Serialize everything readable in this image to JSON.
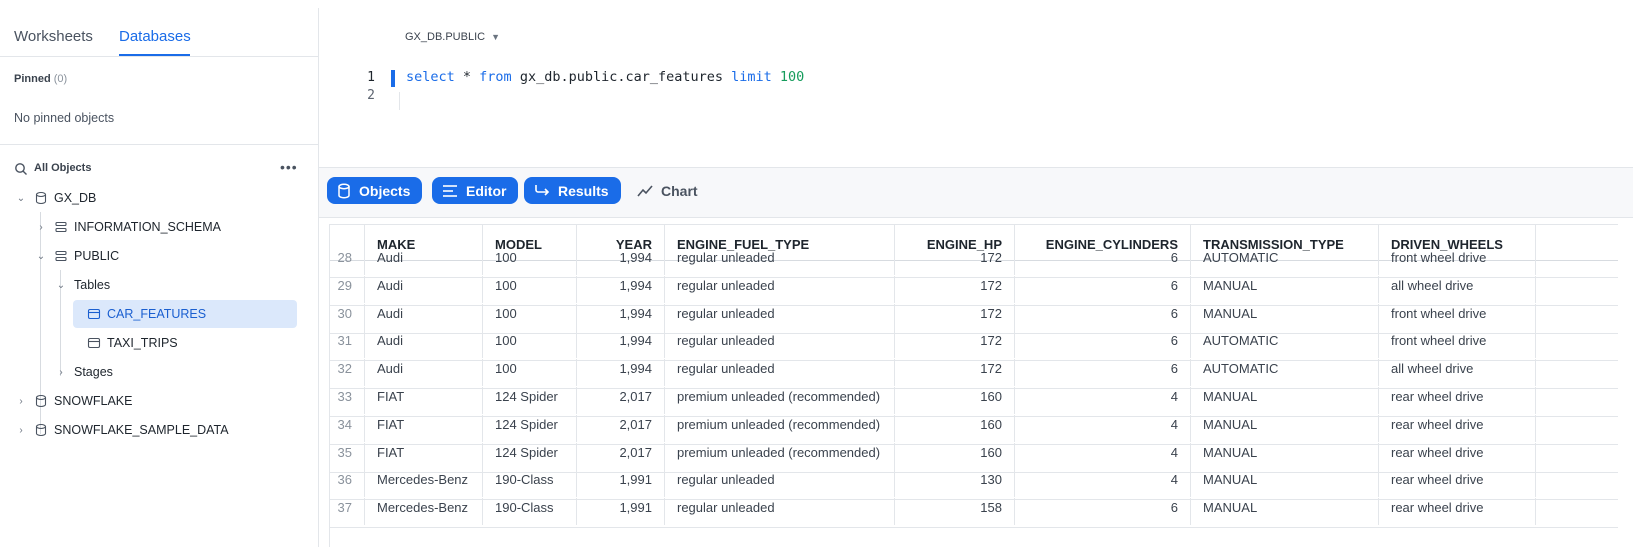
{
  "sidebar": {
    "tabs": [
      {
        "label": "Worksheets"
      },
      {
        "label": "Databases"
      }
    ],
    "pinned": {
      "title": "Pinned",
      "count": "(0)",
      "empty": "No pinned objects"
    },
    "all_objects": {
      "label": "All Objects"
    },
    "tree": [
      {
        "label": "GX_DB"
      },
      {
        "label": "INFORMATION_SCHEMA"
      },
      {
        "label": "PUBLIC"
      },
      {
        "label": "Tables"
      },
      {
        "label": "CAR_FEATURES"
      },
      {
        "label": "TAXI_TRIPS"
      },
      {
        "label": "Stages"
      },
      {
        "label": "SNOWFLAKE"
      },
      {
        "label": "SNOWFLAKE_SAMPLE_DATA"
      }
    ]
  },
  "editor": {
    "context": "GX_DB.PUBLIC",
    "line_numbers": [
      "1",
      "2"
    ],
    "code": {
      "select": "select",
      "star": " * ",
      "from": "from",
      "table": " gx_db.public.car_features ",
      "limit": "limit",
      "count": " 100"
    }
  },
  "toolbar": {
    "objects": "Objects",
    "editor": "Editor",
    "results": "Results",
    "chart": "Chart"
  },
  "results": {
    "columns": [
      "MAKE",
      "MODEL",
      "YEAR",
      "ENGINE_FUEL_TYPE",
      "ENGINE_HP",
      "ENGINE_CYLINDERS",
      "TRANSMISSION_TYPE",
      "DRIVEN_WHEELS"
    ],
    "rows": [
      {
        "n": "28",
        "make": "Audi",
        "model": "100",
        "year": "1,994",
        "fuel": "regular unleaded",
        "hp": "172",
        "cyl": "6",
        "trans": "AUTOMATIC",
        "wheels": "front wheel drive"
      },
      {
        "n": "29",
        "make": "Audi",
        "model": "100",
        "year": "1,994",
        "fuel": "regular unleaded",
        "hp": "172",
        "cyl": "6",
        "trans": "MANUAL",
        "wheels": "all wheel drive"
      },
      {
        "n": "30",
        "make": "Audi",
        "model": "100",
        "year": "1,994",
        "fuel": "regular unleaded",
        "hp": "172",
        "cyl": "6",
        "trans": "MANUAL",
        "wheels": "front wheel drive"
      },
      {
        "n": "31",
        "make": "Audi",
        "model": "100",
        "year": "1,994",
        "fuel": "regular unleaded",
        "hp": "172",
        "cyl": "6",
        "trans": "AUTOMATIC",
        "wheels": "front wheel drive"
      },
      {
        "n": "32",
        "make": "Audi",
        "model": "100",
        "year": "1,994",
        "fuel": "regular unleaded",
        "hp": "172",
        "cyl": "6",
        "trans": "AUTOMATIC",
        "wheels": "all wheel drive"
      },
      {
        "n": "33",
        "make": "FIAT",
        "model": "124 Spider",
        "year": "2,017",
        "fuel": "premium unleaded (recommended)",
        "hp": "160",
        "cyl": "4",
        "trans": "MANUAL",
        "wheels": "rear wheel drive"
      },
      {
        "n": "34",
        "make": "FIAT",
        "model": "124 Spider",
        "year": "2,017",
        "fuel": "premium unleaded (recommended)",
        "hp": "160",
        "cyl": "4",
        "trans": "MANUAL",
        "wheels": "rear wheel drive"
      },
      {
        "n": "35",
        "make": "FIAT",
        "model": "124 Spider",
        "year": "2,017",
        "fuel": "premium unleaded (recommended)",
        "hp": "160",
        "cyl": "4",
        "trans": "MANUAL",
        "wheels": "rear wheel drive"
      },
      {
        "n": "36",
        "make": "Mercedes-Benz",
        "model": "190-Class",
        "year": "1,991",
        "fuel": "regular unleaded",
        "hp": "130",
        "cyl": "4",
        "trans": "MANUAL",
        "wheels": "rear wheel drive"
      },
      {
        "n": "37",
        "make": "Mercedes-Benz",
        "model": "190-Class",
        "year": "1,991",
        "fuel": "regular unleaded",
        "hp": "158",
        "cyl": "6",
        "trans": "MANUAL",
        "wheels": "rear wheel drive"
      }
    ]
  },
  "colors": {
    "accent": "#1a6ce8",
    "selected_bg": "#dbe8fb"
  }
}
